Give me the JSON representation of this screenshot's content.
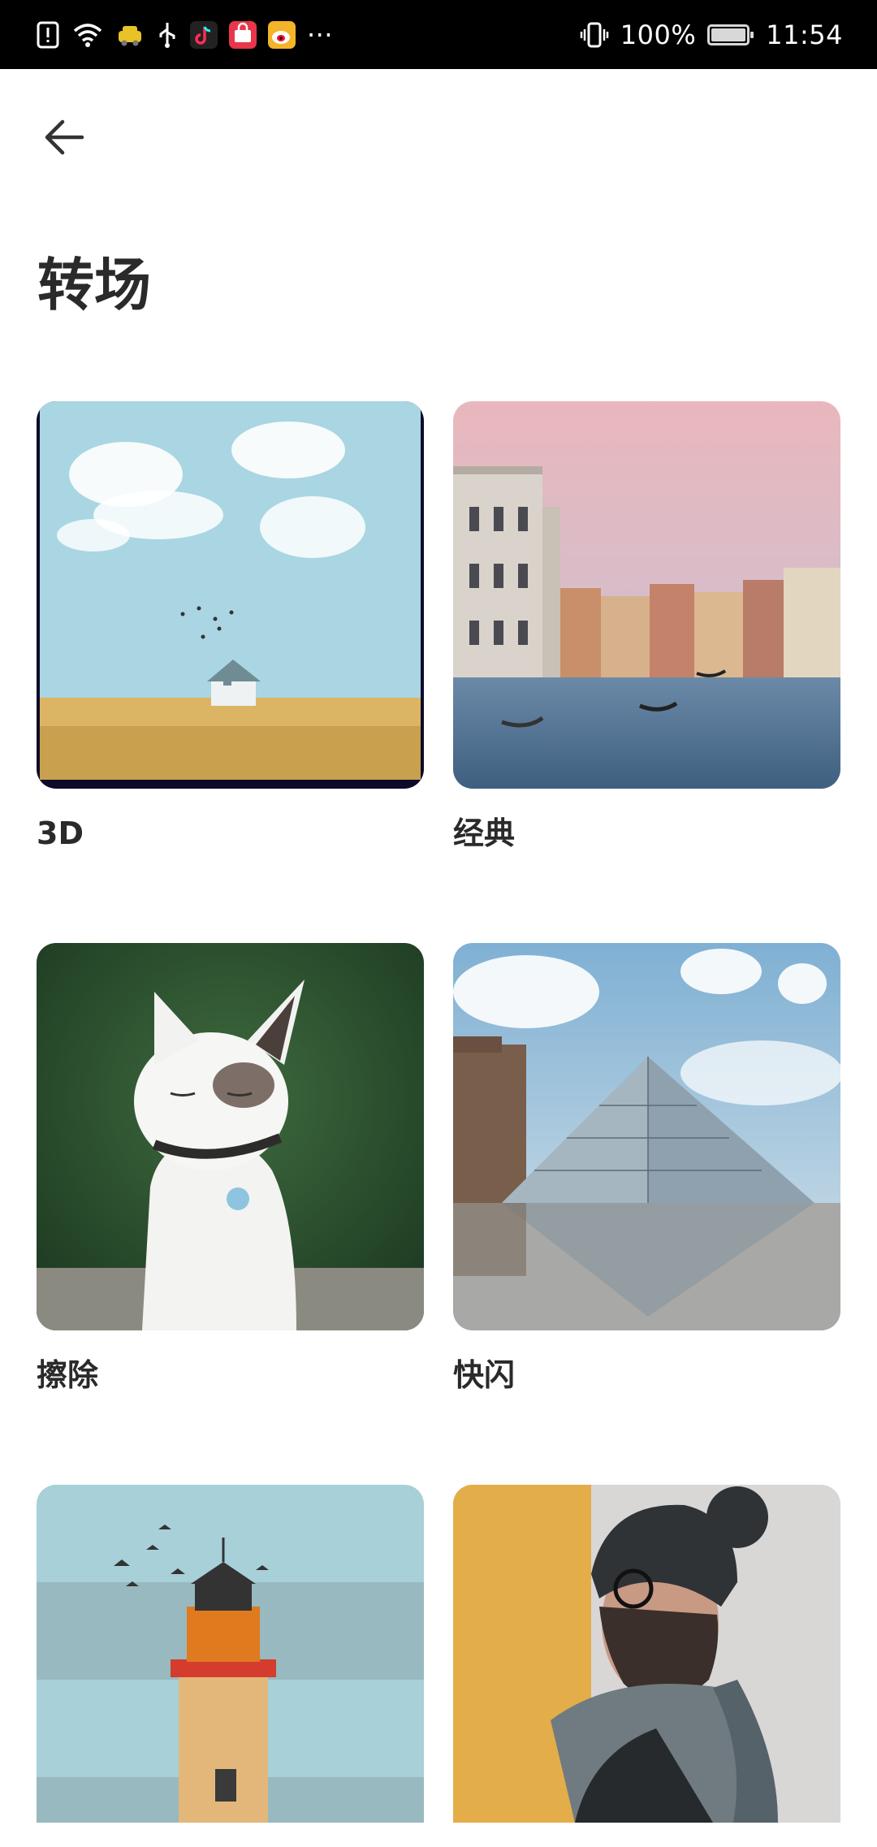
{
  "status_bar": {
    "icons": [
      "alert-icon",
      "wifi-icon",
      "taxi-app-icon",
      "usb-icon",
      "tiktok-icon",
      "shop-app-icon",
      "weibo-icon",
      "more-dots-icon"
    ],
    "more": "···",
    "vibrate_icon": "vibrate-icon",
    "battery_text": "100%",
    "time": "11:54"
  },
  "header": {
    "back_icon": "back-arrow-icon",
    "title": "转场"
  },
  "transitions": [
    {
      "label": "3D",
      "image": "house-in-wheat-field"
    },
    {
      "label": "经典",
      "image": "venice-canal"
    },
    {
      "label": "擦除",
      "image": "white-cat"
    },
    {
      "label": "快闪",
      "image": "louvre-pyramid"
    },
    {
      "label": "",
      "image": "lighthouse"
    },
    {
      "label": "",
      "image": "man-with-beanie"
    }
  ],
  "colors": {
    "background": "#ffffff",
    "status_bar": "#000000",
    "title_text": "#2a2a2a"
  }
}
